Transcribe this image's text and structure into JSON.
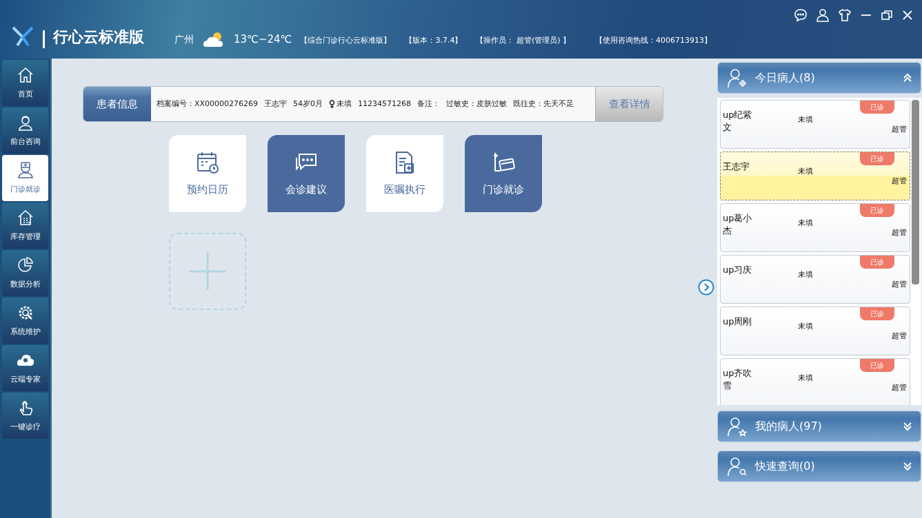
{
  "header": {
    "app_name": "行心云标准版",
    "city": "广州",
    "temperature": "13℃~24℃",
    "edition": "【综合门诊行心云标准版】",
    "version": "【版本：3.7.4】",
    "operator": "【操作员： 超管(管理员) 】",
    "hotline": "【使用咨询热线：4006713913】"
  },
  "sidebar": {
    "items": [
      {
        "kind": "home",
        "label": "首页",
        "selected": false
      },
      {
        "kind": "nurse",
        "label": "前台咨询",
        "selected": false
      },
      {
        "kind": "doctor",
        "label": "门诊就诊",
        "selected": true
      },
      {
        "kind": "warehouse",
        "label": "库存管理",
        "selected": false
      },
      {
        "kind": "pie",
        "label": "数据分析",
        "selected": false
      },
      {
        "kind": "gear",
        "label": "系统维护",
        "selected": false
      },
      {
        "kind": "cloud",
        "label": "云端专家",
        "selected": false
      },
      {
        "kind": "hand",
        "label": "一键诊疗",
        "selected": false
      }
    ]
  },
  "patient_bar": {
    "label": "患者信息",
    "fields": [
      "档案编号：XX00000276269",
      "王志宇",
      "54岁0月",
      "未填",
      "11234571268",
      "备注：",
      "过敏史：皮肤过敏",
      "既往史：先天不足"
    ],
    "detail_button": "查看详情"
  },
  "tiles": [
    {
      "kind": "calendar",
      "label": "预约日历",
      "dark": false
    },
    {
      "kind": "chat",
      "label": "会诊建议",
      "dark": true
    },
    {
      "kind": "document",
      "label": "医嘱执行",
      "dark": false
    },
    {
      "kind": "card",
      "label": "门诊就诊",
      "dark": true
    }
  ],
  "today_panel": {
    "title": "今日病人(8)",
    "expanded": true,
    "patients": [
      {
        "name": "up纪紫文",
        "gender": "未填",
        "status": "已诊",
        "doctor": "超管",
        "selected": false
      },
      {
        "name": "王志宇",
        "gender": "未填",
        "status": "已诊",
        "doctor": "超管",
        "selected": true
      },
      {
        "name": "up葛小杰",
        "gender": "未填",
        "status": "已诊",
        "doctor": "超管",
        "selected": false
      },
      {
        "name": "up习庆",
        "gender": "未填",
        "status": "已诊",
        "doctor": "超管",
        "selected": false
      },
      {
        "name": "up周刚",
        "gender": "未填",
        "status": "已诊",
        "doctor": "超管",
        "selected": false
      },
      {
        "name": "up齐吹雪",
        "gender": "未填",
        "status": "已诊",
        "doctor": "超管",
        "selected": false
      }
    ]
  },
  "other_panels": [
    {
      "kind": "star",
      "title": "我的病人(97)",
      "expanded": false
    },
    {
      "kind": "search",
      "title": "快速查询(0)",
      "expanded": false
    }
  ]
}
